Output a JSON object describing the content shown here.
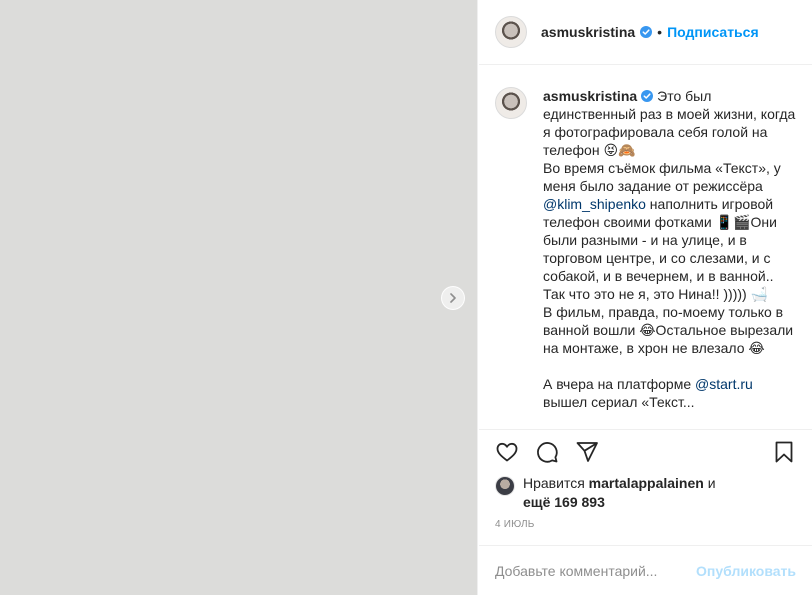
{
  "photo": {
    "placeholder_label": ""
  },
  "header": {
    "username": "asmuskristina",
    "separator": "•",
    "follow_label": "Подписаться"
  },
  "caption": {
    "username": "asmuskristina",
    "part1": "Это был единственный раз в моей жизни, когда я фотографировала себя голой на телефон 😝🙈\nВо время съёмок фильма «Текст», у меня было задание от режиссёра ",
    "mention1": "@klim_shipenko",
    "part2": " наполнить игровой телефон своими фотками 📱🎬Они были разными - и на улице, и в торговом центре, и со слезами, и с собакой, и в вечернем, и в ванной.. Так что это не я, это Нина!! ))))) 🛁\nВ фильм, правда, по-моему только в ванной вошли 😂Остальное вырезали на монтаже, в хрон не влезало 😂\n\nА вчера на платформе ",
    "mention2": "@start.ru",
    "part3": " вышел сериал «Текст..."
  },
  "likes": {
    "prefix": "Нравится",
    "user": "martalappalainen",
    "joiner": "и",
    "count_text": "ещё 169 893"
  },
  "date": "4 ИЮЛЬ",
  "comment": {
    "placeholder": "Добавьте комментарий...",
    "post_label": "Опубликовать"
  },
  "colors": {
    "accent": "#0095f6",
    "text": "#262626",
    "muted": "#8e8e8e",
    "post_disabled": "#b2dffc",
    "mention": "#00376b"
  }
}
